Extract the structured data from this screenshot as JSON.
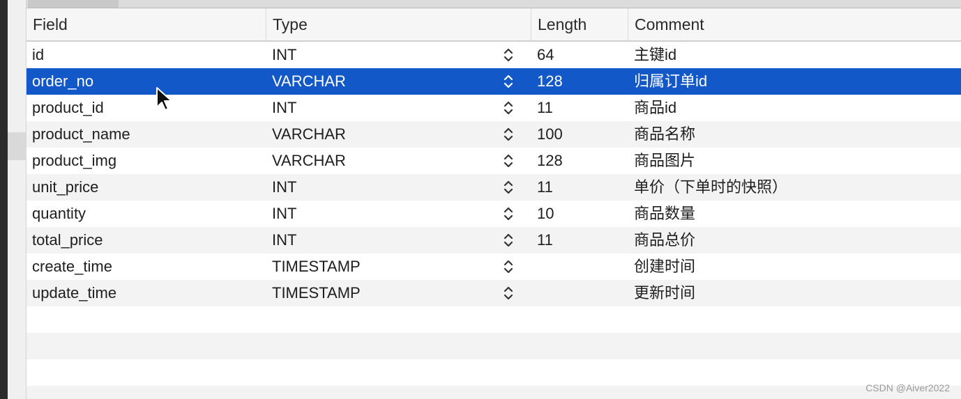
{
  "table": {
    "columns": [
      "Field",
      "Type",
      "Length",
      "Comment"
    ],
    "rows": [
      {
        "field": "id",
        "type": "INT",
        "length": "64",
        "comment": "主键id",
        "selected": false
      },
      {
        "field": "order_no",
        "type": "VARCHAR",
        "length": "128",
        "comment": "归属订单id",
        "selected": true
      },
      {
        "field": "product_id",
        "type": "INT",
        "length": "11",
        "comment": "商品id",
        "selected": false
      },
      {
        "field": "product_name",
        "type": "VARCHAR",
        "length": "100",
        "comment": "商品名称",
        "selected": false
      },
      {
        "field": "product_img",
        "type": "VARCHAR",
        "length": "128",
        "comment": "商品图片",
        "selected": false
      },
      {
        "field": "unit_price",
        "type": "INT",
        "length": "11",
        "comment": "单价（下单时的快照）",
        "selected": false
      },
      {
        "field": "quantity",
        "type": "INT",
        "length": "10",
        "comment": "商品数量",
        "selected": false
      },
      {
        "field": "total_price",
        "type": "INT",
        "length": "11",
        "comment": "商品总价",
        "selected": false
      },
      {
        "field": "create_time",
        "type": "TIMESTAMP",
        "length": "",
        "comment": "创建时间",
        "selected": false
      },
      {
        "field": "update_time",
        "type": "TIMESTAMP",
        "length": "",
        "comment": "更新时间",
        "selected": false
      }
    ],
    "empty_rows": 4
  },
  "icons": {
    "type_stepper": "chevron-up-down-icon",
    "mouse_pointer": "arrow-cursor-icon"
  },
  "colors": {
    "selection": "#1258c8",
    "header_bg": "#f6f6f6",
    "alt_row": "#f3f3f3"
  },
  "watermark": "CSDN @Aiver2022"
}
